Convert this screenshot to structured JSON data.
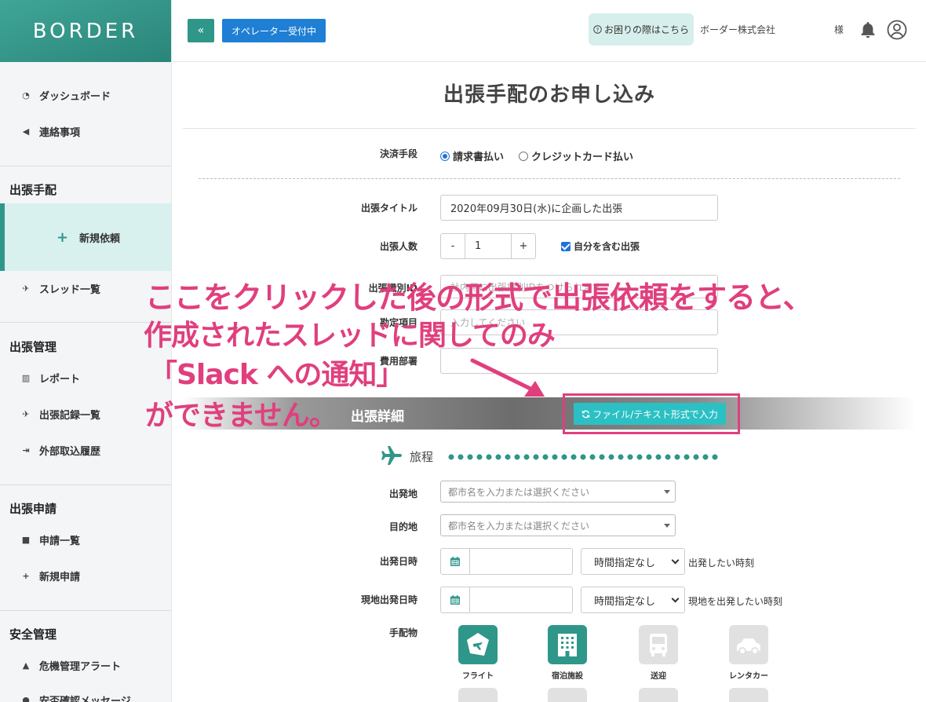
{
  "brand": {
    "logo_text": "BORDER"
  },
  "header": {
    "collapse_label": "«",
    "operator_label": "オペレーター受付中",
    "help_label": "お困りの際はこちら",
    "help_icon": "question-circle-icon",
    "company": "ボーダー株式会社",
    "honorific": "様"
  },
  "sidebar": {
    "items_top": [
      {
        "label": "ダッシュボード",
        "icon": "dashboard-icon",
        "glyph": "◔"
      },
      {
        "label": "連絡事項",
        "icon": "megaphone-icon",
        "glyph": "◀"
      }
    ],
    "sections": [
      {
        "heading": "出張手配"
      },
      {
        "heading": "出張管理"
      },
      {
        "heading": "出張申請"
      },
      {
        "heading": "安全管理"
      }
    ],
    "active_item": {
      "label": "新規依頼",
      "glyph": "+"
    },
    "thread_item": {
      "label": "スレッド一覧",
      "glyph": "✈"
    },
    "management_items": [
      {
        "label": "レポート",
        "glyph": "▥"
      },
      {
        "label": "出張記録一覧",
        "glyph": "✈"
      },
      {
        "label": "外部取込履歴",
        "glyph": "⇥"
      }
    ],
    "application_items": [
      {
        "label": "申請一覧",
        "glyph": "■"
      },
      {
        "label": "新規申請",
        "glyph": "+"
      }
    ],
    "safety_items": [
      {
        "label": "危機管理アラート",
        "glyph": "▲"
      },
      {
        "label": "安否確認メッセージ",
        "glyph": "●"
      }
    ]
  },
  "main": {
    "title": "出張手配のお申し込み",
    "payment": {
      "label": "決済手段",
      "options": [
        {
          "label": "請求書払い",
          "selected": true
        },
        {
          "label": "クレジットカード払い",
          "selected": false
        }
      ]
    },
    "trip_title": {
      "label": "出張タイトル",
      "value": "2020年09月30日(水)に企画した出張"
    },
    "headcount": {
      "label": "出張人数",
      "minus": "-",
      "value": "1",
      "plus": "+",
      "include_self_label": "自分を含む出張",
      "include_self": true
    },
    "trip_id": {
      "label": "出張識別ID",
      "placeholder": "社内用に出張識別IDをつけられます"
    },
    "account": {
      "label": "勘定項目",
      "placeholder": "入力してください"
    },
    "department": {
      "label": "費用部署",
      "placeholder": ""
    },
    "detail_header": "出張詳細",
    "file_input_button": "ファイル/テキスト形式で入力",
    "itinerary_label": "旅程",
    "departure_place": {
      "label": "出発地",
      "placeholder": "都市名を入力または選択ください"
    },
    "destination": {
      "label": "目的地",
      "placeholder": "都市名を入力または選択ください"
    },
    "departure_datetime": {
      "label": "出発日時",
      "time_value": "時間指定なし",
      "note": "出発したい時刻"
    },
    "local_departure_datetime": {
      "label": "現地出発日時",
      "time_value": "時間指定なし",
      "note": "現地を出発したい時刻"
    },
    "arrangements": {
      "label": "手配物",
      "items": [
        {
          "label": "フライト",
          "icon": "flight-ticket-icon",
          "active": true
        },
        {
          "label": "宿泊施設",
          "icon": "hotel-icon",
          "active": true
        },
        {
          "label": "送迎",
          "icon": "bus-icon",
          "active": false
        },
        {
          "label": "レンタカー",
          "icon": "car-icon",
          "active": false
        }
      ]
    }
  },
  "annotation": {
    "line1": "ここをクリックした後の形式で出張依頼をすると、",
    "line2": "作成されたスレッドに関してのみ",
    "line3": "「Slack への通知」",
    "line4": "ができません。",
    "color": "#e03f7e"
  },
  "colors": {
    "teal": "#2f9789",
    "blue": "#1e7fd4",
    "cyan_button": "#2bc0c4",
    "annotation": "#e03f7e"
  }
}
